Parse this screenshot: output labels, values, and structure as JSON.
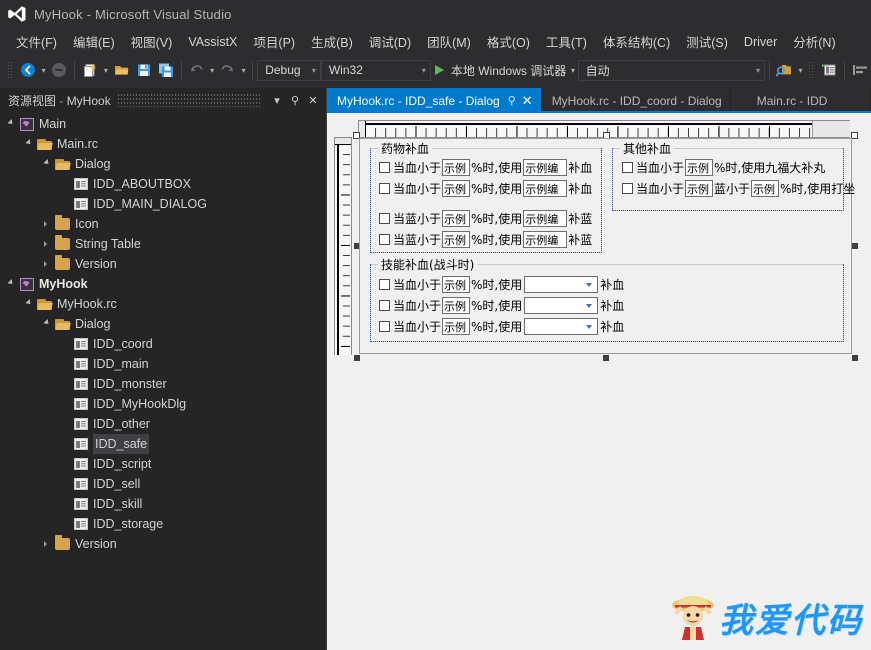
{
  "window": {
    "title": "MyHook - Microsoft Visual Studio",
    "logo_icon": "visual-studio-logo-icon"
  },
  "menubar": {
    "items": [
      {
        "label": "文件(F)"
      },
      {
        "label": "编辑(E)"
      },
      {
        "label": "视图(V)"
      },
      {
        "label": "VAssistX"
      },
      {
        "label": "项目(P)"
      },
      {
        "label": "生成(B)"
      },
      {
        "label": "调试(D)"
      },
      {
        "label": "团队(M)"
      },
      {
        "label": "格式(O)"
      },
      {
        "label": "工具(T)"
      },
      {
        "label": "体系结构(C)"
      },
      {
        "label": "测试(S)"
      },
      {
        "label": "Driver"
      },
      {
        "label": "分析(N)"
      }
    ]
  },
  "toolbar": {
    "nav_back_icon": "navigate-back-icon",
    "nav_forward_icon": "navigate-forward-icon",
    "new_item_icon": "new-item-icon",
    "open_file_icon": "open-file-icon",
    "save_icon": "save-icon",
    "save_all_icon": "save-all-icon",
    "undo_icon": "undo-icon",
    "redo_icon": "redo-icon",
    "config_combo": "Debug",
    "platform_combo": "Win32",
    "run_label": "本地 Windows 调试器",
    "auto_combo": "自动",
    "find_icon": "find-in-files-icon",
    "properties_icon": "properties-window-icon",
    "align_icon": "align-icon"
  },
  "left_panel": {
    "title_main": "资源视图",
    "title_sep": " - ",
    "title_sub": "MyHook",
    "dropdown_icon": "chevron-down-icon",
    "pin_icon": "pin-icon",
    "close_icon": "close-icon",
    "tree": [
      {
        "label": "Main",
        "indent": 0,
        "twisty": "expanded",
        "icon": "project-icon",
        "bold": false,
        "selected": false
      },
      {
        "label": "Main.rc",
        "indent": 1,
        "twisty": "expanded",
        "icon": "folder-open-icon",
        "bold": false,
        "selected": false
      },
      {
        "label": "Dialog",
        "indent": 2,
        "twisty": "expanded",
        "icon": "folder-open-icon",
        "bold": false,
        "selected": false
      },
      {
        "label": "IDD_ABOUTBOX",
        "indent": 3,
        "twisty": "leaf",
        "icon": "dialog-resource-icon",
        "bold": false,
        "selected": false
      },
      {
        "label": "IDD_MAIN_DIALOG",
        "indent": 3,
        "twisty": "leaf",
        "icon": "dialog-resource-icon",
        "bold": false,
        "selected": false
      },
      {
        "label": "Icon",
        "indent": 2,
        "twisty": "collapsed",
        "icon": "folder-icon",
        "bold": false,
        "selected": false
      },
      {
        "label": "String Table",
        "indent": 2,
        "twisty": "collapsed",
        "icon": "folder-icon",
        "bold": false,
        "selected": false
      },
      {
        "label": "Version",
        "indent": 2,
        "twisty": "collapsed",
        "icon": "folder-icon",
        "bold": false,
        "selected": false
      },
      {
        "label": "MyHook",
        "indent": 0,
        "twisty": "expanded",
        "icon": "project-icon",
        "bold": true,
        "selected": false
      },
      {
        "label": "MyHook.rc",
        "indent": 1,
        "twisty": "expanded",
        "icon": "folder-open-icon",
        "bold": false,
        "selected": false
      },
      {
        "label": "Dialog",
        "indent": 2,
        "twisty": "expanded",
        "icon": "folder-open-icon",
        "bold": false,
        "selected": false
      },
      {
        "label": "IDD_coord",
        "indent": 3,
        "twisty": "leaf",
        "icon": "dialog-resource-icon",
        "bold": false,
        "selected": false
      },
      {
        "label": "IDD_main",
        "indent": 3,
        "twisty": "leaf",
        "icon": "dialog-resource-icon",
        "bold": false,
        "selected": false
      },
      {
        "label": "IDD_monster",
        "indent": 3,
        "twisty": "leaf",
        "icon": "dialog-resource-icon",
        "bold": false,
        "selected": false
      },
      {
        "label": "IDD_MyHookDlg",
        "indent": 3,
        "twisty": "leaf",
        "icon": "dialog-resource-icon",
        "bold": false,
        "selected": false
      },
      {
        "label": "IDD_other",
        "indent": 3,
        "twisty": "leaf",
        "icon": "dialog-resource-icon",
        "bold": false,
        "selected": false
      },
      {
        "label": "IDD_safe",
        "indent": 3,
        "twisty": "leaf",
        "icon": "dialog-resource-icon",
        "bold": false,
        "selected": true
      },
      {
        "label": "IDD_script",
        "indent": 3,
        "twisty": "leaf",
        "icon": "dialog-resource-icon",
        "bold": false,
        "selected": false
      },
      {
        "label": "IDD_sell",
        "indent": 3,
        "twisty": "leaf",
        "icon": "dialog-resource-icon",
        "bold": false,
        "selected": false
      },
      {
        "label": "IDD_skill",
        "indent": 3,
        "twisty": "leaf",
        "icon": "dialog-resource-icon",
        "bold": false,
        "selected": false
      },
      {
        "label": "IDD_storage",
        "indent": 3,
        "twisty": "leaf",
        "icon": "dialog-resource-icon",
        "bold": false,
        "selected": false
      },
      {
        "label": "Version",
        "indent": 2,
        "twisty": "collapsed",
        "icon": "folder-icon",
        "bold": false,
        "selected": false
      }
    ]
  },
  "tabs": {
    "accent_color": "#007acc",
    "items": [
      {
        "label": "MyHook.rc - IDD_safe - Dialog",
        "active": true,
        "pin_icon": "pin-icon",
        "close_icon": "close-icon"
      },
      {
        "label": "MyHook.rc - IDD_coord - Dialog",
        "active": false
      },
      {
        "label": "Main.rc - IDD",
        "active": false
      }
    ]
  },
  "designer": {
    "groups": [
      {
        "title": "药物补血",
        "rows": [
          {
            "prefix": "当血小于",
            "edit1": "示例",
            "mid": "%时,使用",
            "edit2": "示例编",
            "suffix": "补血",
            "checked": false,
            "control": "edit"
          },
          {
            "prefix": "当血小于",
            "edit1": "示例",
            "mid": "%时,使用",
            "edit2": "示例编",
            "suffix": "补血",
            "checked": false,
            "control": "edit"
          },
          {
            "prefix": "当蓝小于",
            "edit1": "示例",
            "mid": "%时,使用",
            "edit2": "示例编",
            "suffix": "补蓝",
            "checked": false,
            "control": "edit"
          },
          {
            "prefix": "当蓝小于",
            "edit1": "示例",
            "mid": "%时,使用",
            "edit2": "示例编",
            "suffix": "补蓝",
            "checked": false,
            "control": "edit"
          }
        ]
      },
      {
        "title": "其他补血",
        "rows": [
          {
            "prefix": "当血小于",
            "edit1": "示例",
            "mid": "%时,使用九福大补丸",
            "edit2": "",
            "suffix": "",
            "checked": false,
            "control": "none"
          },
          {
            "prefix": "当血小于",
            "edit1": "示例",
            "mid": "蓝小于",
            "edit2": "示例",
            "suffix": "%时,使用打坐",
            "checked": false,
            "control": "none"
          }
        ]
      },
      {
        "title": "技能补血(战斗时)",
        "rows": [
          {
            "prefix": "当血小于",
            "edit1": "示例",
            "mid": "%时,使用",
            "edit2": "",
            "suffix": "补血",
            "checked": false,
            "control": "combo"
          },
          {
            "prefix": "当血小于",
            "edit1": "示例",
            "mid": "%时,使用",
            "edit2": "",
            "suffix": "补血",
            "checked": false,
            "control": "combo"
          },
          {
            "prefix": "当血小于",
            "edit1": "示例",
            "mid": "%时,使用",
            "edit2": "",
            "suffix": "补血",
            "checked": false,
            "control": "combo"
          }
        ]
      }
    ]
  },
  "watermark": {
    "text": "我爱代码",
    "mascot_icon": "straw-hat-mascot-icon",
    "color": "#2196f3"
  }
}
